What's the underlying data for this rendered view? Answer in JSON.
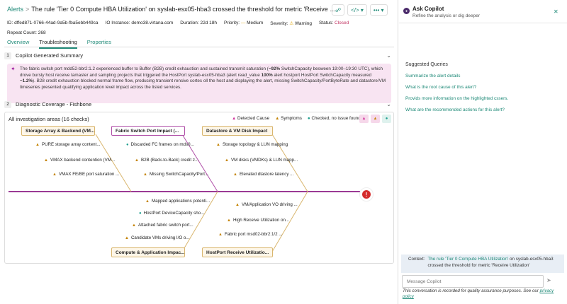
{
  "header": {
    "breadcrumb": "Alerts",
    "separator": ">",
    "title": "The rule 'Tier 0 Compute HBA Utilization' on syslab-esx05-hba3 crossed the threshold for metric 'Receive Utilization'",
    "share_icon": "share-icon",
    "code_icon": "code-icon",
    "more_icon": "more-icon"
  },
  "meta": {
    "id": "ID: dffed871-0766-44ad-9a5b-fba5ebb449ca",
    "io_instance": "IO Instance: demo38.virtana.com",
    "duration": "Duration: 22d 18h",
    "priority_label": "Priority:",
    "priority_value": "Medium",
    "severity_label": "Severity:",
    "severity_value": "Warning",
    "status_label": "Status:",
    "status_value": "Closed",
    "repeat": "Repeat Count: 268"
  },
  "tabs": [
    "Overview",
    "Troubleshooting",
    "Properties"
  ],
  "summary": {
    "num": "1",
    "title": "Copilot Generated Summary",
    "text_a": "The fabric switch port mdd52-bbr2:1.2 experienced buffer to Buffer (B2B) credit exhaustion and sustained transmit saturation (",
    "text_b": "~92%",
    "text_c": " SwitchCapacity besween 19:00–19:30 UTC), which drove bursty host receive tamaster and sampling projects that triggered the HostPort syslab-esx05-hba3 (alert read_value ",
    "text_d": "100%",
    "text_e": " alert hostport HostPort SwitchCapacity measured ",
    "text_f": "~1.2%",
    "text_g": "). B28 credit exhaustion blocked normal frame flow, producing transient rensive cortes oll the host and displaying the alert, missing SwitchCapacity/PortByteRate and datastore/VM timeseries presented quatifying application level impact across the listed services."
  },
  "diag": {
    "num": "2",
    "title": "Diagnostic Coverage - Fishbone",
    "all_label": "All investigation areas (16 checks)",
    "legend": [
      "Detected Cause",
      "Symptoms",
      "Checked, no issue found"
    ],
    "nodes": [
      "Storage Array & Backend (VM...",
      "Fabric Switch Port Impact (...",
      "Datastore & VM Disk Impact",
      "Compute & Application Impac...",
      "HostPort Receive Utilizatio..."
    ],
    "leaves_top": [
      "PURE storage array content...",
      "VMAX backend contention (VM...",
      "VMAX FE/BE port saturation ...",
      "Discarded FC frames on mds0...",
      "B2B (Back-to-Back) credit z...",
      "Missing SwitchCapacity/Port...",
      "Storage topology & LUN mapping",
      "VM disks (VMDKs) & LUN mapp...",
      "Elevated dtastore latency ..."
    ],
    "leaves_bottom": [
      "Mapped applications potenti...",
      "HostPort DeviceCapacity sho...",
      "Attached fabric switch port...",
      "Candidate VMs driving I/O o...",
      "VM/Application VO driving ...",
      "High Receive Utilization on...",
      "Fabric port msd02-bbr2:1/2 ..."
    ],
    "head_icon": "!"
  },
  "side": {
    "title": "Ask Copilot",
    "subtitle": "Refine the analysis or dig deeper",
    "suggest_title": "Suggested Queries",
    "queries": [
      "Summarize the alert details",
      "What is the root cause of this alert?",
      "Provids more information on the highlighted cssers.",
      "What are the recommended actions for this alert?"
    ],
    "context_label": "Context:",
    "context_link": "The rule 'Tier 0 Compute HBA Utilization'",
    "context_mid": " on ",
    "context_host": "syslab-esx05-hba3",
    "context_rest": " crossed the threshold for metric 'Receive Utilization'",
    "placeholder": "Message Copilot",
    "footer": "This conversation is recorded for quality assurance purposes. See our ",
    "footer_link": "privacy policy"
  },
  "colors": {
    "accent": "#1f8a78",
    "cause": "#b050a8",
    "symptom": "#d9b66e",
    "alert": "#d42b2b"
  }
}
